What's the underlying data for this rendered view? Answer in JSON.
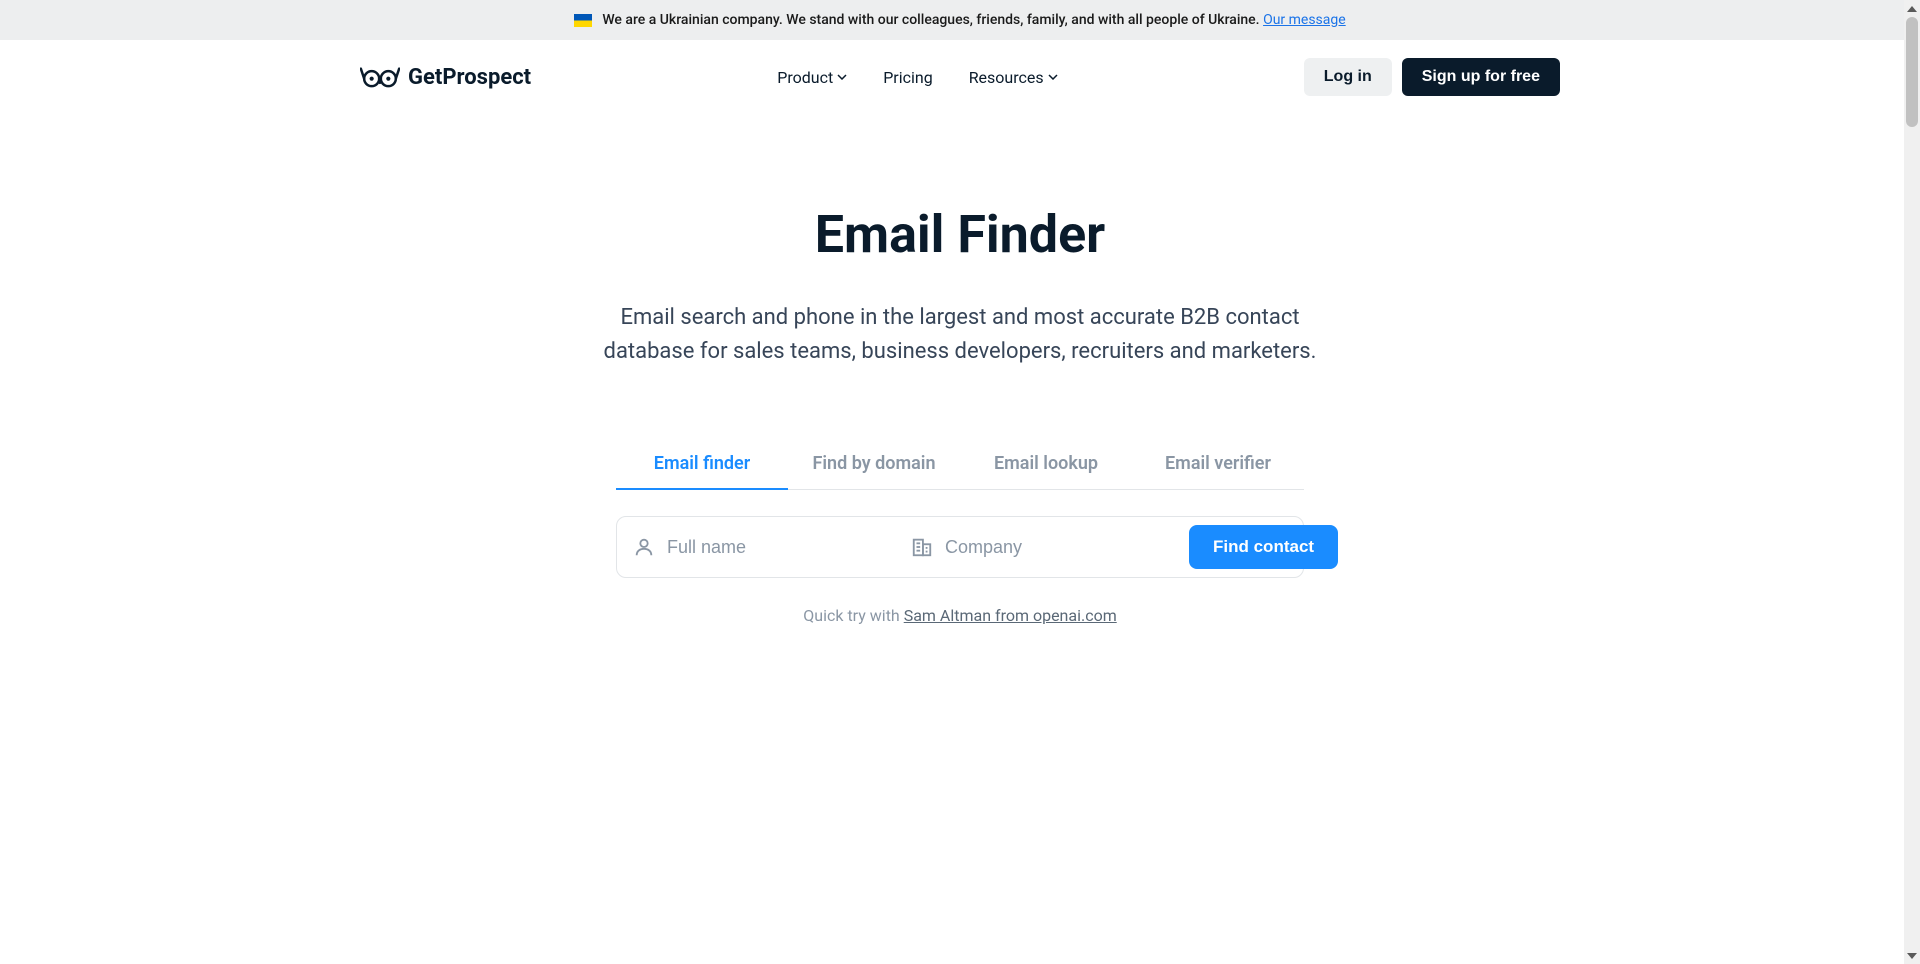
{
  "announcement": {
    "text": "We are a Ukrainian company. We stand with our colleagues, friends, family, and with all people of Ukraine. ",
    "link_text": "Our message"
  },
  "header": {
    "brand": "GetProspect",
    "nav": {
      "product": "Product",
      "pricing": "Pricing",
      "resources": "Resources"
    },
    "login": "Log in",
    "signup": "Sign up for free"
  },
  "hero": {
    "title": "Email Finder",
    "subtitle": "Email search and phone in the largest and most accurate B2B contact database for sales teams, business developers, recruiters and marketers."
  },
  "tabs": {
    "items": [
      {
        "label": "Email finder"
      },
      {
        "label": "Find by domain"
      },
      {
        "label": "Email lookup"
      },
      {
        "label": "Email verifier"
      }
    ]
  },
  "search": {
    "fullname_placeholder": "Full name",
    "company_placeholder": "Company",
    "button": "Find contact"
  },
  "quicktry": {
    "prefix": "Quick try with ",
    "link": "Sam Altman from openai.com"
  }
}
